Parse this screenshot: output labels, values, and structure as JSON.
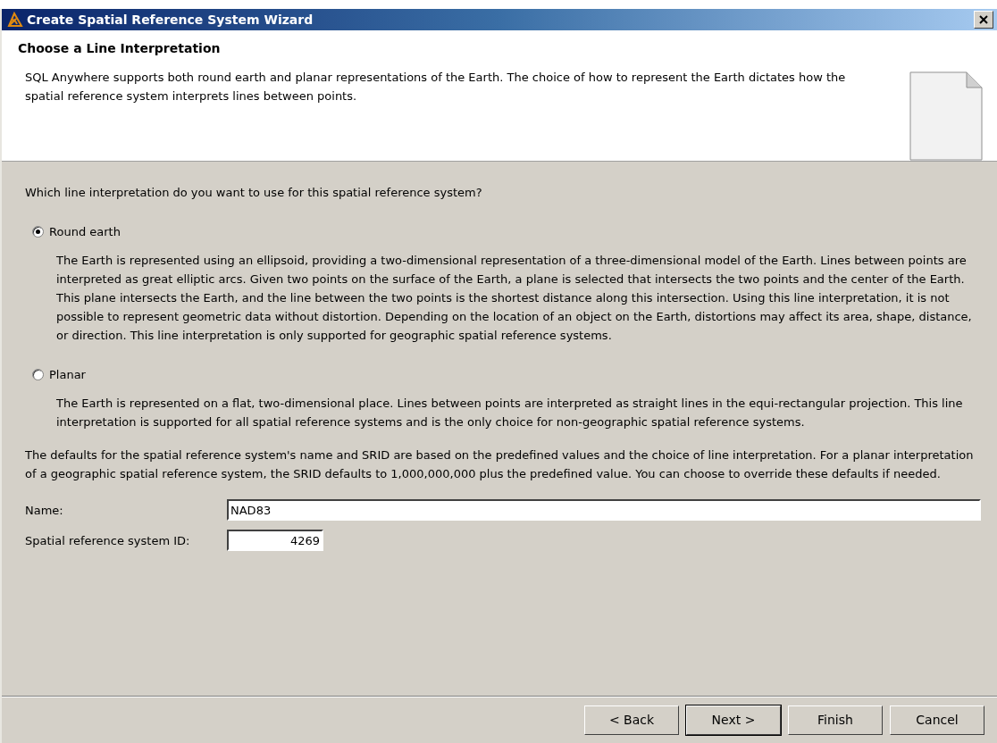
{
  "window": {
    "title": "Create Spatial Reference System Wizard"
  },
  "header": {
    "title": "Choose a Line Interpretation",
    "description": "SQL Anywhere supports both round earth and planar representations of the Earth. The choice of how to represent the Earth dictates how the spatial reference system interprets lines between points."
  },
  "question": "Which line interpretation do you want to use for this spatial reference system?",
  "options": [
    {
      "label": "Round earth",
      "selected": true,
      "description": "The Earth is represented using an ellipsoid, providing a two-dimensional representation of a three-dimensional model of the Earth. Lines between points are interpreted as great elliptic arcs. Given two points on the surface of the Earth, a plane is selected that intersects the two points and the center of the Earth. This plane intersects the Earth, and the line between the two points is the shortest distance along this intersection. Using this line interpretation, it is not possible to represent geometric data without distortion. Depending on the location of an object on the Earth, distortions may affect its area, shape, distance, or direction. This line interpretation is only supported for geographic spatial reference systems."
    },
    {
      "label": "Planar",
      "selected": false,
      "description": "The Earth is represented on a flat, two-dimensional place. Lines between points are interpreted as straight lines in the equi-rectangular projection. This line interpretation is supported for all spatial reference systems and is the only choice for non-geographic spatial reference systems."
    }
  ],
  "defaults_note": "The defaults for the spatial reference system's name and SRID are based on the predefined values and the choice of line interpretation. For a planar interpretation of a geographic spatial reference system, the SRID defaults to 1,000,000,000 plus the predefined value. You can choose to override these defaults if needed.",
  "fields": [
    {
      "kind": "wide",
      "label": "Name:",
      "value": "NAD83"
    },
    {
      "kind": "number",
      "label": "Spatial reference system ID:",
      "value": "4269"
    }
  ],
  "buttons": [
    {
      "label": "< Back",
      "default": false
    },
    {
      "label": "Next >",
      "default": true
    },
    {
      "label": "Finish",
      "default": false
    },
    {
      "label": "Cancel",
      "default": false
    }
  ]
}
